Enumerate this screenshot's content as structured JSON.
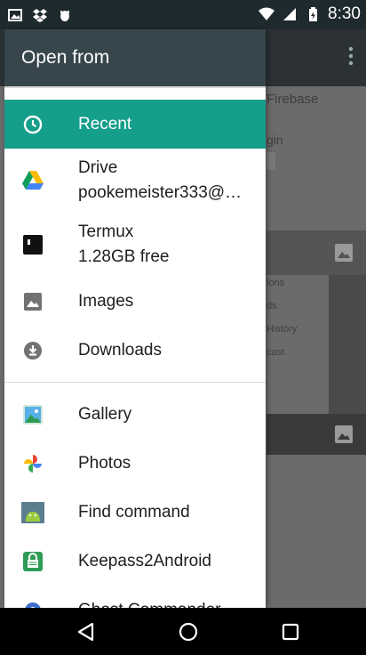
{
  "status_bar": {
    "time": "8:30",
    "icons": [
      "photo-notification-icon",
      "dropbox-icon",
      "android-debug-icon",
      "wifi-icon",
      "signal-icon",
      "battery-icon"
    ]
  },
  "background_app": {
    "title_fragment": "Firebase",
    "sub_fragment": "gin",
    "list_fragments": [
      "ions",
      "ds",
      "History",
      "cast"
    ]
  },
  "drawer": {
    "title": "Open from",
    "active_color": "#159e8a",
    "header_color": "#37464d",
    "items": [
      {
        "label": "Recent",
        "icon": "clock-icon"
      },
      {
        "label": "Drive",
        "sub": "pookemeister333@…",
        "icon": "google-drive-icon"
      },
      {
        "label": "Termux",
        "sub": "1.28GB free",
        "icon": "termux-icon"
      },
      {
        "label": "Images",
        "icon": "image-icon"
      },
      {
        "label": "Downloads",
        "icon": "download-icon"
      },
      {
        "label": "Gallery",
        "icon": "gallery-icon"
      },
      {
        "label": "Photos",
        "icon": "google-photos-icon"
      },
      {
        "label": "Find command",
        "icon": "find-command-icon"
      },
      {
        "label": "Keepass2Android",
        "icon": "keepass-icon"
      },
      {
        "label": "Ghost Commander",
        "icon": "ghost-commander-icon"
      }
    ]
  },
  "navbar": {
    "buttons": [
      "back-button",
      "home-button",
      "recents-button"
    ]
  }
}
